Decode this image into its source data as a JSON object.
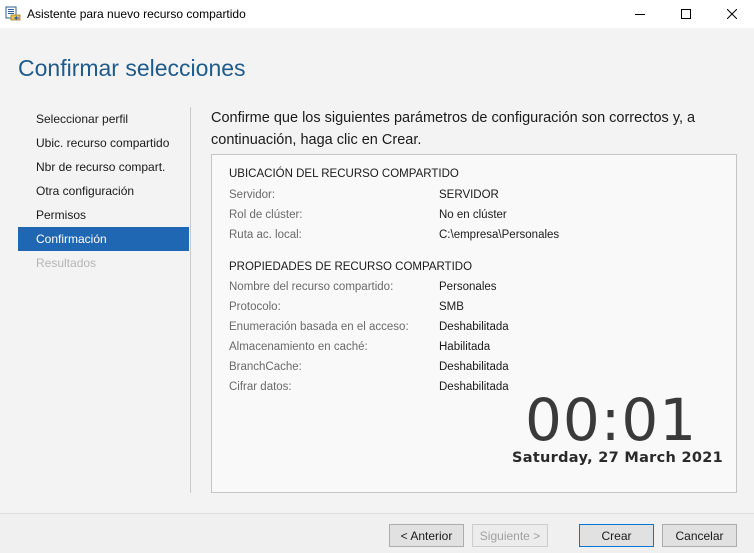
{
  "window": {
    "title": "Asistente para nuevo recurso compartido"
  },
  "page": {
    "title": "Confirmar selecciones"
  },
  "sidebar": {
    "items": [
      {
        "label": "Seleccionar perfil",
        "state": "normal"
      },
      {
        "label": "Ubic. recurso compartido",
        "state": "normal"
      },
      {
        "label": "Nbr de recurso compart.",
        "state": "normal"
      },
      {
        "label": "Otra configuración",
        "state": "normal"
      },
      {
        "label": "Permisos",
        "state": "normal"
      },
      {
        "label": "Confirmación",
        "state": "active"
      },
      {
        "label": "Resultados",
        "state": "disabled"
      }
    ]
  },
  "main": {
    "instruction": "Confirme que los siguientes parámetros de configuración son correctos y, a continuación, haga clic en Crear.",
    "sections": [
      {
        "heading": "UBICACIÓN DEL RECURSO COMPARTIDO",
        "rows": [
          {
            "key": "Servidor:",
            "value": "SERVIDOR"
          },
          {
            "key": "Rol de clúster:",
            "value": "No en clúster"
          },
          {
            "key": "Ruta ac. local:",
            "value": "C:\\empresa\\Personales"
          }
        ]
      },
      {
        "heading": "PROPIEDADES DE RECURSO COMPARTIDO",
        "rows": [
          {
            "key": "Nombre del recurso compartido:",
            "value": "Personales"
          },
          {
            "key": "Protocolo:",
            "value": "SMB"
          },
          {
            "key": "Enumeración basada en el acceso:",
            "value": "Deshabilitada"
          },
          {
            "key": "Almacenamiento en caché:",
            "value": "Habilitada"
          },
          {
            "key": "BranchCache:",
            "value": "Deshabilitada"
          },
          {
            "key": "Cifrar datos:",
            "value": "Deshabilitada"
          }
        ]
      }
    ]
  },
  "clock": {
    "time": "00:01",
    "date": "Saturday, 27 March 2021"
  },
  "buttons": {
    "previous": "< Anterior",
    "next": "Siguiente >",
    "create": "Crear",
    "cancel": "Cancelar"
  },
  "icons": {
    "app": "share-folder-wizard-icon",
    "minimize": "minimize-icon",
    "maximize": "maximize-icon",
    "close": "close-icon"
  },
  "colors": {
    "accent": "#1f66b3",
    "title": "#1e5b8c"
  }
}
